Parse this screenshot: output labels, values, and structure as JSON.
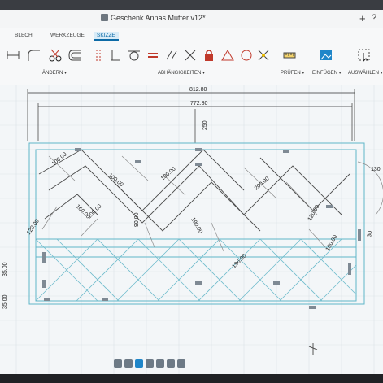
{
  "window": {
    "title": "Geschenk Annas Mutter v12*",
    "plus": "+",
    "help": "?"
  },
  "ribbon": {
    "tabs": [
      {
        "label": "BLECH",
        "active": false
      },
      {
        "label": "WERKZEUGE",
        "active": false
      },
      {
        "label": "SKIZZE",
        "active": true
      }
    ],
    "groups": {
      "change": "ÄNDERN ▾",
      "constraints": "ABHÄNGIGKEITEN ▾",
      "inspect": "PRÜFEN ▾",
      "insert": "EINFÜGEN ▾",
      "select": "AUSWÄHLEN ▾"
    },
    "icons": [
      "fillet-icon",
      "offset-icon",
      "trim-scissors-icon",
      "sketch-palette-icon",
      "perpendicular-icon",
      "tangent-icon",
      "equal-icon",
      "parallel-icon",
      "collinear-icon",
      "lock-icon",
      "triangle-icon",
      "circle-icon",
      "midpoint-icon",
      "ruler-icon",
      "image-insert-icon",
      "cursor-select-icon"
    ]
  },
  "dimensions": {
    "overall_width": "812.80",
    "inner_width": "772.80",
    "height": "250",
    "d100": "100.00",
    "d120": "120.00",
    "d160": "160.00",
    "d200": "200.00",
    "d90": "90.00",
    "d196": "196.00",
    "d190": "190.00",
    "d35": "35.00",
    "d130": "130",
    "d30": "30"
  },
  "navbar": {
    "icons": [
      "orbit-icon",
      "pan-icon",
      "zoom-icon",
      "fit-icon",
      "display-icon",
      "grid-icon",
      "viewport-icon"
    ]
  },
  "colors": {
    "accent": "#1f86c9",
    "sketch": "#59b3c9",
    "dim": "#222222",
    "constraint": "#6e6e6e"
  }
}
